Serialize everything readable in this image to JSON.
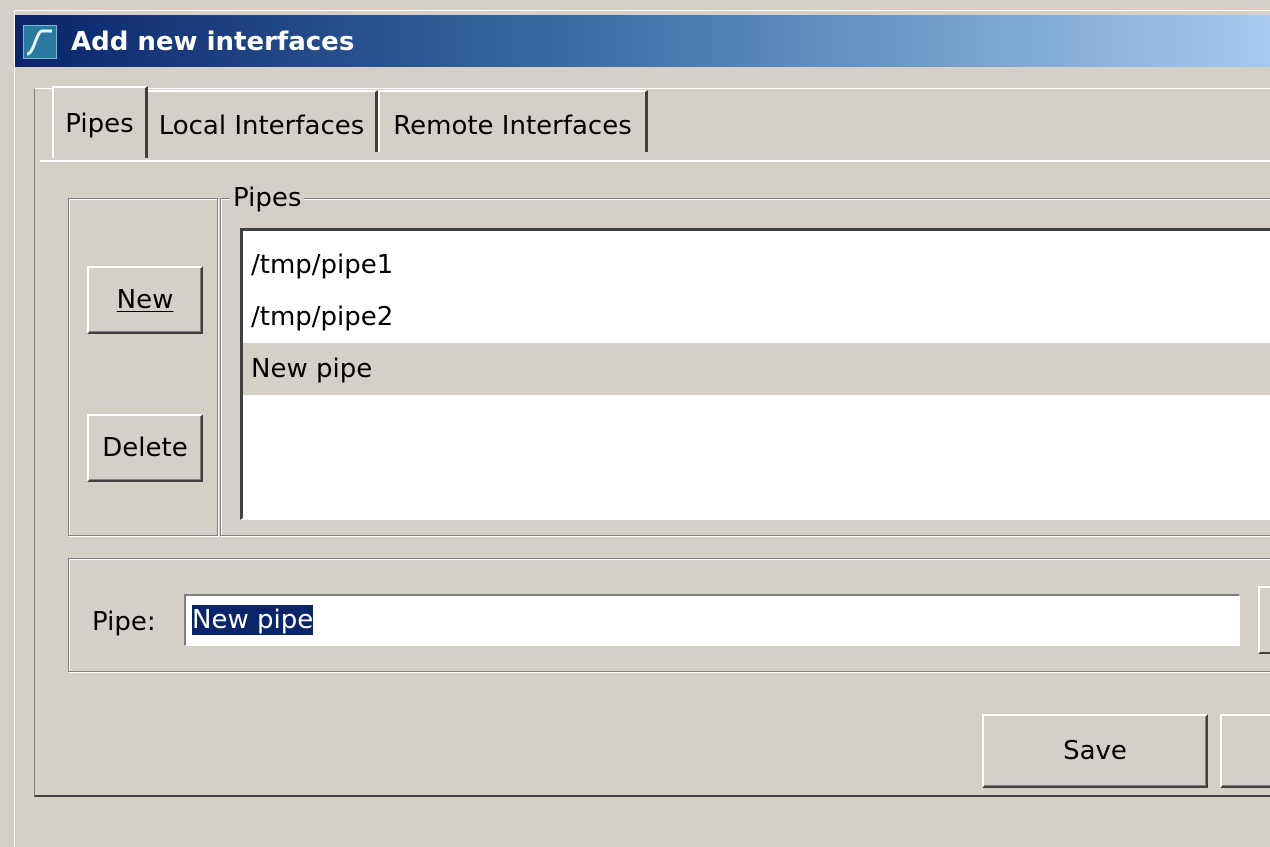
{
  "window": {
    "title": "Add new interfaces"
  },
  "tabs": [
    {
      "label": "Pipes",
      "active": true
    },
    {
      "label": "Local Interfaces",
      "active": false
    },
    {
      "label": "Remote Interfaces",
      "active": false
    }
  ],
  "buttons": {
    "new_label": "New",
    "delete_label": "Delete",
    "save_label": "Save"
  },
  "pipes_group": {
    "title": "Pipes",
    "items": [
      {
        "label": "/tmp/pipe1",
        "selected": false
      },
      {
        "label": "/tmp/pipe2",
        "selected": false
      },
      {
        "label": "New pipe",
        "selected": true
      }
    ]
  },
  "pipe_field": {
    "label": "Pipe:",
    "value": "New pipe"
  },
  "colors": {
    "title_gradient_start": "#0a246a",
    "title_gradient_end": "#a6caf0",
    "face": "#d4d0c8",
    "selection": "#0a246a"
  },
  "icons": {
    "app": "wireshark-fin-icon"
  }
}
